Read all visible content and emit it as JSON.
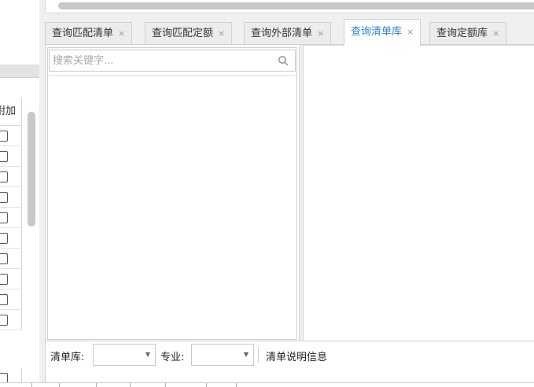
{
  "tabs": [
    {
      "label": "查询匹配清单",
      "close": "×",
      "active": false
    },
    {
      "label": "查询匹配定额",
      "close": "×",
      "active": false
    },
    {
      "label": "查询外部清单",
      "close": "×",
      "active": false
    },
    {
      "label": "查询清单库",
      "close": "×",
      "active": true
    },
    {
      "label": "查询定额库",
      "close": "×",
      "active": false
    }
  ],
  "search": {
    "placeholder": "搜索关键字...",
    "value": "",
    "icon": "search-icon"
  },
  "left_table": {
    "column_header": "附加"
  },
  "toolbar": {
    "library_label": "清单库:",
    "library_value": "",
    "major_label": "专业:",
    "major_value": "",
    "dropdown_arrow": "▼",
    "description": "清单说明信息"
  },
  "colors": {
    "active_tab_text": "#2d7fd0",
    "border": "#d0d0d0",
    "scroll_thumb": "#c8c8c8"
  }
}
